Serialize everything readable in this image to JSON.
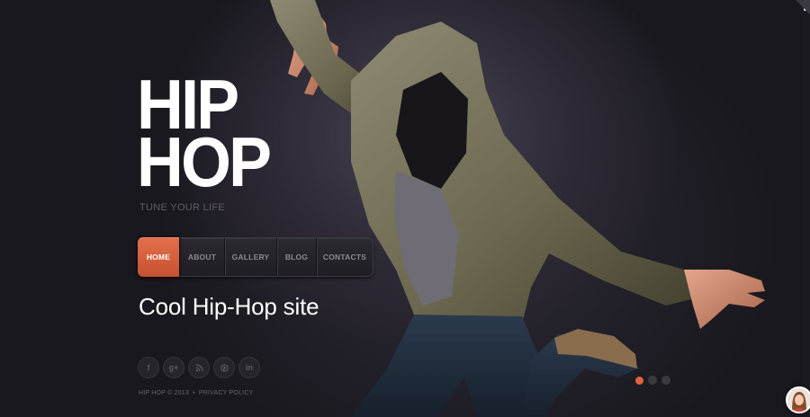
{
  "site": {
    "logo_line1": "HIP",
    "logo_line2": "HOP",
    "tagline": "TUNE YOUR LIFE"
  },
  "nav": {
    "items": [
      {
        "label": "HOME",
        "active": true
      },
      {
        "label": "ABOUT",
        "active": false
      },
      {
        "label": "GALLERY",
        "active": false
      },
      {
        "label": "BLOG",
        "active": false
      },
      {
        "label": "CONTACTS",
        "active": false
      }
    ]
  },
  "hero": {
    "headline": "Cool Hip-Hop site"
  },
  "social": [
    {
      "icon": "facebook-icon",
      "glyph": "f"
    },
    {
      "icon": "google-plus-icon",
      "glyph": "g+"
    },
    {
      "icon": "rss-icon",
      "glyph": "⌇"
    },
    {
      "icon": "pinterest-icon",
      "glyph": "℗"
    },
    {
      "icon": "linkedin-icon",
      "glyph": "in"
    }
  ],
  "footer": {
    "copyright": "HIP HOP © 2013",
    "separator": "•",
    "privacy": "PRIVACY POLICY"
  },
  "slider": {
    "slides": 3,
    "active_index": 0
  },
  "colors": {
    "accent": "#e0643e",
    "background": "#15141a",
    "text_primary": "#ffffff",
    "text_muted": "#67646d"
  }
}
